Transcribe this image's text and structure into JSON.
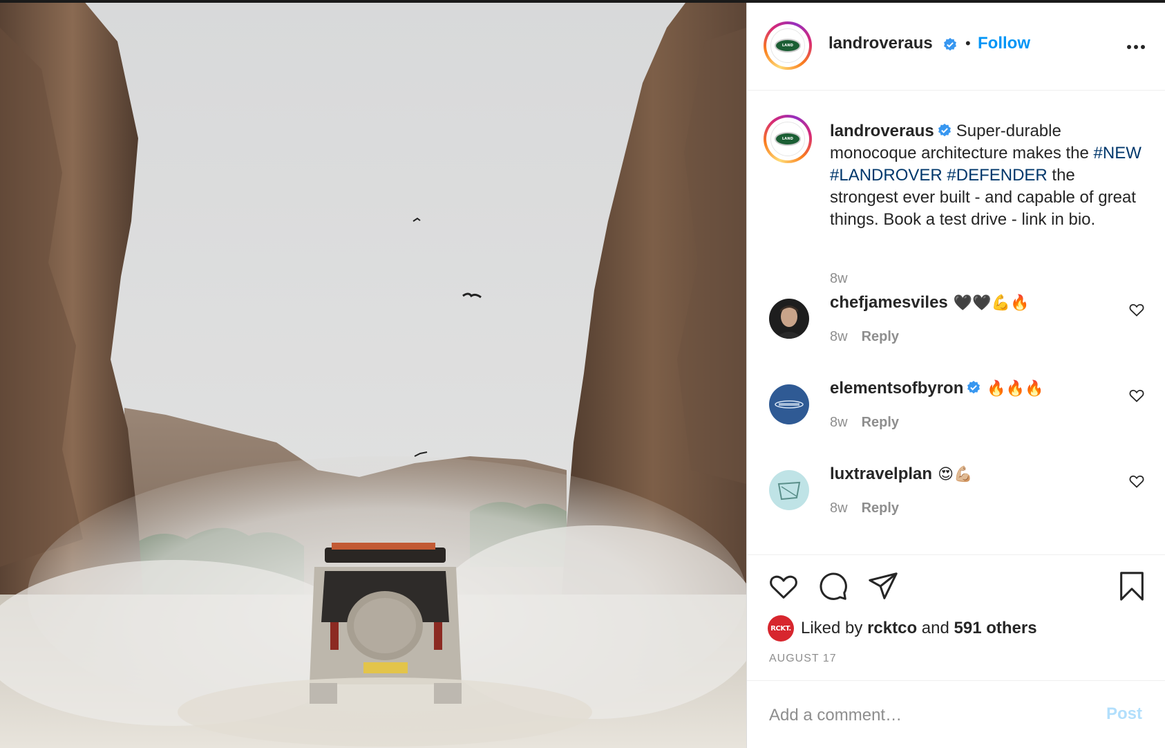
{
  "post": {
    "username": "landroveraus",
    "follow_label": "Follow",
    "separator": "•",
    "avatar_logo_text": "LAND ROVER"
  },
  "caption": {
    "username": "landroveraus",
    "text_part1": "Super-durable monocoque architecture makes the ",
    "hashtags": [
      "#NEW",
      "#LANDROVER",
      "#DEFENDER"
    ],
    "text_part2": " the strongest ever built - and capable of great things. Book a test drive - link in bio.",
    "age": "8w"
  },
  "comments": [
    {
      "username": "chefjamesviles",
      "verified": false,
      "emoji": "🖤🖤💪🔥",
      "age": "8w",
      "reply_label": "Reply",
      "avatar_color": "#2b2b2b"
    },
    {
      "username": "elementsofbyron",
      "verified": true,
      "emoji": "🔥🔥🔥",
      "age": "8w",
      "reply_label": "Reply",
      "avatar_color": "#2f5a94"
    },
    {
      "username": "luxtravelplan",
      "verified": false,
      "emoji": "😍💪🏼",
      "age": "8w",
      "reply_label": "Reply",
      "avatar_color": "#bfe3e6"
    }
  ],
  "likes": {
    "avatar_text": "RCKT.",
    "prefix": "Liked by",
    "liker": "rcktco",
    "conjunction": "and",
    "others": "591 others"
  },
  "date": "AUGUST 17",
  "add_comment": {
    "placeholder": "Add a comment…",
    "post_label": "Post"
  },
  "colors": {
    "link_blue": "#0095f6",
    "hashtag": "#00376b",
    "muted": "#8e8e8e",
    "post_disabled": "#b2dffc",
    "rckt_red": "#d7262e"
  },
  "icons": [
    "verified-badge-icon",
    "more-options-icon",
    "heart-icon",
    "comment-icon",
    "share-icon",
    "bookmark-icon"
  ]
}
